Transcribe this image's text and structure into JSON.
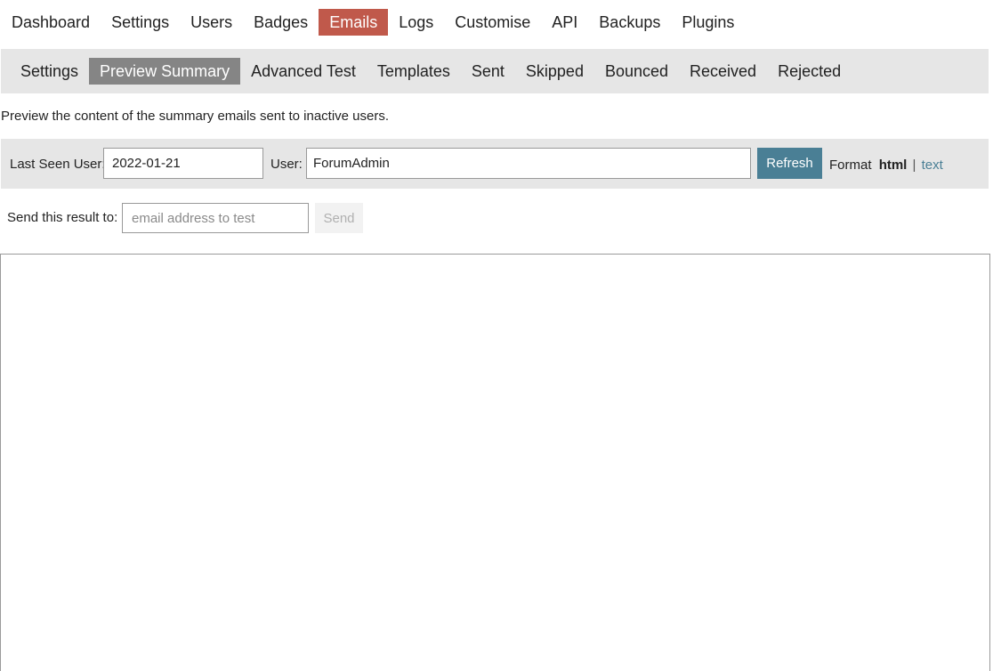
{
  "top_nav": {
    "items": [
      {
        "label": "Dashboard"
      },
      {
        "label": "Settings"
      },
      {
        "label": "Users"
      },
      {
        "label": "Badges"
      },
      {
        "label": "Emails",
        "active": true
      },
      {
        "label": "Logs"
      },
      {
        "label": "Customise"
      },
      {
        "label": "API"
      },
      {
        "label": "Backups"
      },
      {
        "label": "Plugins"
      }
    ]
  },
  "sub_nav": {
    "items": [
      {
        "label": "Settings"
      },
      {
        "label": "Preview Summary",
        "active": true
      },
      {
        "label": "Advanced Test"
      },
      {
        "label": "Templates"
      },
      {
        "label": "Sent"
      },
      {
        "label": "Skipped"
      },
      {
        "label": "Bounced"
      },
      {
        "label": "Received"
      },
      {
        "label": "Rejected"
      }
    ]
  },
  "description": "Preview the content of the summary emails sent to inactive users.",
  "filters": {
    "last_seen_label": "Last Seen User:",
    "last_seen_value": "2022-01-21",
    "user_label": "User:",
    "user_value": "ForumAdmin",
    "refresh_label": "Refresh",
    "format_label": "Format",
    "format_html": "html",
    "format_separator": "|",
    "format_text": "text"
  },
  "send": {
    "label": "Send this result to:",
    "placeholder": "email address to test",
    "button_label": "Send"
  },
  "colors": {
    "active_top_tab": "#c0594b",
    "active_sub_tab": "#858585",
    "bar_background": "#e6e6e6",
    "refresh_button": "#4a7f95",
    "link": "#4a7f95"
  }
}
